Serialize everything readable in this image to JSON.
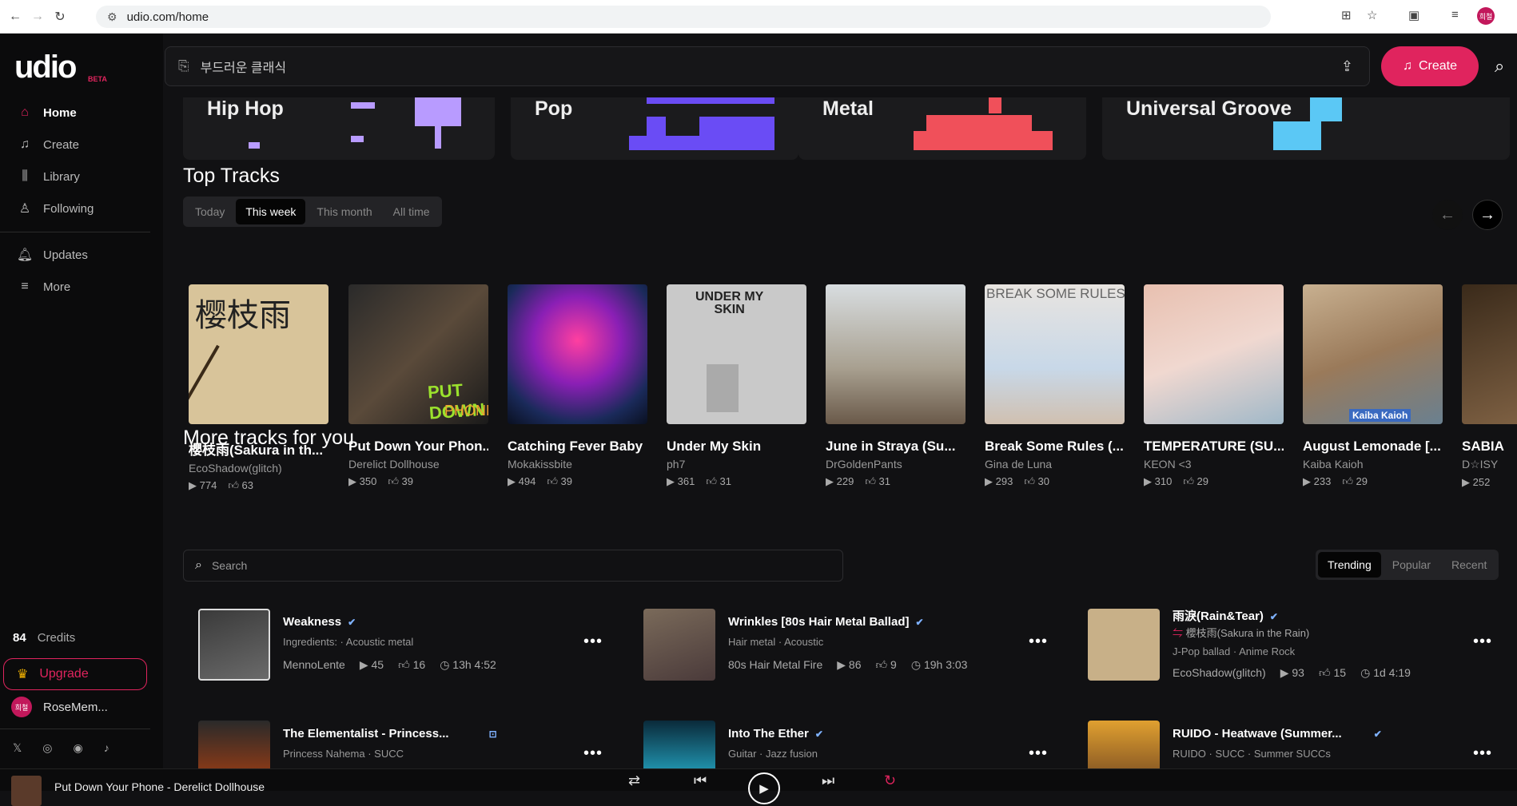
{
  "browser": {
    "url": "udio.com/home",
    "tooltip": "Tooltip"
  },
  "sidebar": {
    "logo": "udio",
    "beta": "BETA",
    "items": [
      {
        "label": "Home",
        "icon": "home-icon"
      },
      {
        "label": "Create",
        "icon": "music-note-icon"
      },
      {
        "label": "Library",
        "icon": "library-icon"
      },
      {
        "label": "Following",
        "icon": "user-icon"
      },
      {
        "label": "Updates",
        "icon": "bell-icon"
      },
      {
        "label": "More",
        "icon": "menu-icon"
      }
    ],
    "credits_count": "84",
    "credits_label": "Credits",
    "upgrade": "Upgrade",
    "user_name": "RoseMem...",
    "user_avatar": "희철"
  },
  "topbar": {
    "search_placeholder": "부드러운 클래식",
    "create_label": "Create"
  },
  "genres": [
    "Hip Hop",
    "Pop",
    "Metal",
    "Universal Groove"
  ],
  "top_tracks": {
    "title": "Top Tracks",
    "tabs": [
      "Today",
      "This week",
      "This month",
      "All time"
    ],
    "cards": [
      {
        "title": "櫻枝雨(Sakura in th...",
        "artist": "EcoShadow(glitch)",
        "plays": "774",
        "likes": "63"
      },
      {
        "title": "Put Down Your Phon...",
        "artist": "Derelict Dollhouse",
        "plays": "350",
        "likes": "39"
      },
      {
        "title": "Catching Fever Baby",
        "artist": "Mokakissbite",
        "plays": "494",
        "likes": "39"
      },
      {
        "title": "Under My Skin",
        "artist": "ph7",
        "plays": "361",
        "likes": "31"
      },
      {
        "title": "June in Straya (Su...",
        "artist": "DrGoldenPants",
        "plays": "229",
        "likes": "31"
      },
      {
        "title": "Break Some Rules (...",
        "artist": "Gina de Luna",
        "plays": "293",
        "likes": "30"
      },
      {
        "title": "TEMPERATURE (SU...",
        "artist": "KEON <3",
        "plays": "310",
        "likes": "29"
      },
      {
        "title": "August Lemonade [...",
        "artist": "Kaiba Kaioh",
        "plays": "233",
        "likes": "29"
      },
      {
        "title": "SABIA",
        "artist": "D☆ISY",
        "plays": "252",
        "likes": ""
      }
    ]
  },
  "more_tracks": {
    "title": "More tracks for you",
    "search_placeholder": "Search",
    "tabs": [
      "Trending",
      "Popular",
      "Recent"
    ],
    "items": [
      {
        "title": "Weakness",
        "tags": "Ingredients:  ·  Acoustic metal",
        "artist": "MennoLente",
        "plays": "45",
        "likes": "16",
        "age": "13h",
        "duration": "4:52",
        "sub": ""
      },
      {
        "title": "Wrinkles [80s Hair Metal Ballad]",
        "tags": "Hair metal  ·  Acoustic",
        "artist": "80s Hair Metal Fire",
        "plays": "86",
        "likes": "9",
        "age": "19h",
        "duration": "3:03",
        "sub": ""
      },
      {
        "title": "雨淚(Rain&Tear)",
        "tags": "J-Pop ballad  ·  Anime Rock",
        "artist": "EcoShadow(glitch)",
        "plays": "93",
        "likes": "15",
        "age": "1d",
        "duration": "4:19",
        "sub": "櫻枝雨(Sakura in the Rain)"
      },
      {
        "title": "The Elementalist - Princess...",
        "tags": "Princess Nahema  ·  SUCC",
        "artist": "",
        "plays": "",
        "likes": "",
        "age": "",
        "duration": "",
        "sub": ""
      },
      {
        "title": "Into The Ether",
        "tags": "Guitar  ·  Jazz fusion",
        "artist": "",
        "plays": "",
        "likes": "",
        "age": "",
        "duration": "",
        "sub": ""
      },
      {
        "title": "RUIDO - Heatwave (Summer...",
        "tags": "RUIDO  ·  SUCC  ·  Summer SUCCs",
        "artist": "",
        "plays": "",
        "likes": "",
        "age": "",
        "duration": "",
        "sub": ""
      }
    ]
  },
  "player": {
    "now_playing": "Put Down Your Phone - Derelict Dollhouse"
  },
  "colors": {
    "accent": "#e0245e",
    "bg": "#111113"
  }
}
